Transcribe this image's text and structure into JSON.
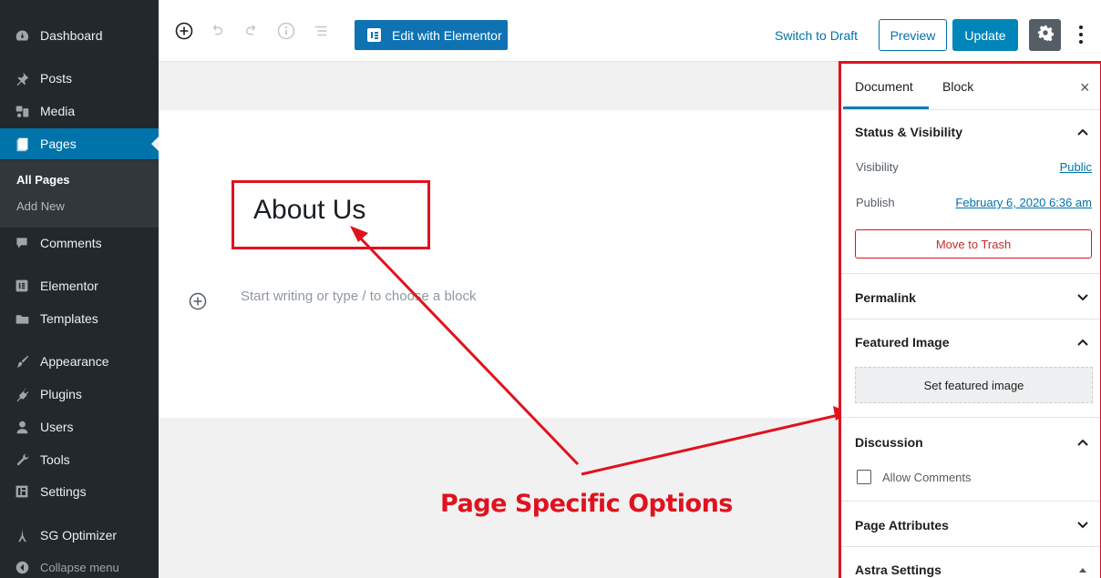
{
  "sidebar": {
    "items": [
      {
        "label": "Dashboard",
        "icon": "dashboard-icon"
      },
      {
        "label": "Posts",
        "icon": "pin-icon"
      },
      {
        "label": "Media",
        "icon": "media-icon"
      },
      {
        "label": "Pages",
        "icon": "pages-icon",
        "active": true
      },
      {
        "label": "Comments",
        "icon": "comment-icon"
      },
      {
        "label": "Elementor",
        "icon": "elementor-icon"
      },
      {
        "label": "Templates",
        "icon": "folder-icon"
      },
      {
        "label": "Appearance",
        "icon": "paintbrush-icon"
      },
      {
        "label": "Plugins",
        "icon": "plug-icon"
      },
      {
        "label": "Users",
        "icon": "users-icon"
      },
      {
        "label": "Tools",
        "icon": "wrench-icon"
      },
      {
        "label": "Settings",
        "icon": "settings-icon"
      },
      {
        "label": "SG Optimizer",
        "icon": "tower-icon"
      }
    ],
    "submenu": {
      "all_pages": "All Pages",
      "add_new": "Add New"
    },
    "collapse": "Collapse menu"
  },
  "toolbar": {
    "edit_elementor": "Edit with Elementor",
    "switch_draft": "Switch to Draft",
    "preview": "Preview",
    "update": "Update"
  },
  "editor": {
    "title": "About Us",
    "placeholder": "Start writing or type / to choose a block"
  },
  "annotation": {
    "label": "Page Specific Options",
    "color": "#e0121e"
  },
  "panel": {
    "tabs": {
      "document": "Document",
      "block": "Block"
    },
    "close": "×",
    "status": {
      "title": "Status & Visibility",
      "visibility_label": "Visibility",
      "visibility_value": "Public",
      "publish_label": "Publish",
      "publish_value": "February 6, 2020 6:36 am",
      "trash": "Move to Trash"
    },
    "permalink": "Permalink",
    "featured": {
      "title": "Featured Image",
      "button": "Set featured image"
    },
    "discussion": {
      "title": "Discussion",
      "allow_comments": "Allow Comments"
    },
    "page_attributes": "Page Attributes",
    "astra": "Astra Settings"
  },
  "colors": {
    "admin_bg": "#23282d",
    "accent": "#0073aa",
    "annotation": "#e0121e"
  }
}
